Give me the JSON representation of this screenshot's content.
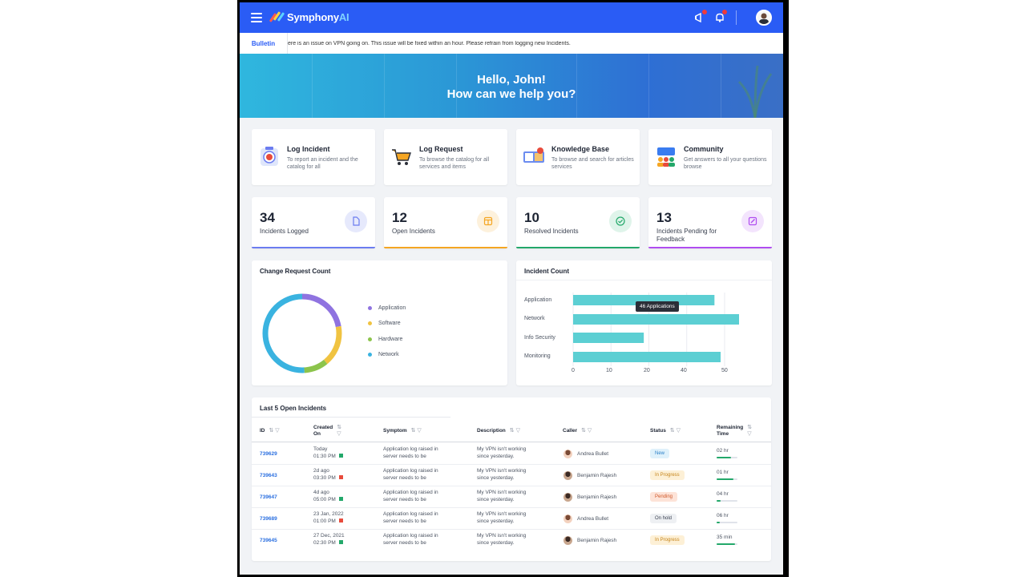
{
  "topbar": {
    "brand": "Symphony",
    "brand_suffix": "AI",
    "notification_count": "1"
  },
  "bulletin": {
    "label": "Bulletin",
    "text": "ere is an issue on VPN going on. This issue will be fixed within an hour. Please refrain from logging new Incidents."
  },
  "hero": {
    "greeting": "Hello, John!",
    "prompt": "How can we help you?"
  },
  "quick_actions": [
    {
      "title": "Log Incident",
      "desc": "To report an incident and the catalog for all",
      "icon": "incident-icon"
    },
    {
      "title": "Log Request",
      "desc": "To browse the catalog for all services and items",
      "icon": "cart-icon"
    },
    {
      "title": "Knowledge Base",
      "desc": "To browse and search for articles services",
      "icon": "knowledge-icon"
    },
    {
      "title": "Community",
      "desc": "Get answers to all your questions browse",
      "icon": "community-icon"
    }
  ],
  "stats": [
    {
      "value": "34",
      "label": "Incidents Logged",
      "color": "#6b7cf0",
      "icon": "document-icon"
    },
    {
      "value": "12",
      "label": "Open Incidents",
      "color": "#f5a623",
      "icon": "box-icon"
    },
    {
      "value": "10",
      "label": "Resolved Incidents",
      "color": "#23a86a",
      "icon": "check-icon"
    },
    {
      "value": "13",
      "label": "Incidents Pending for Feedback",
      "color": "#b04df0",
      "icon": "edit-icon"
    }
  ],
  "change_request": {
    "title": "Change Request Count",
    "chart_data": {
      "type": "pie",
      "categories": [
        "Application",
        "Software",
        "Hardware",
        "Network"
      ],
      "values": [
        22,
        17,
        10,
        51
      ],
      "colors": [
        "#8f73e0",
        "#f0c341",
        "#8cc44c",
        "#3ab3e0"
      ]
    }
  },
  "incident_count": {
    "title": "Incident Count",
    "tooltip": "46 Applications",
    "chart_data": {
      "type": "bar",
      "orientation": "horizontal",
      "categories": [
        "Application",
        "Network",
        "Info Security",
        "Monitoring"
      ],
      "values": [
        46,
        54,
        23,
        48
      ],
      "xlim": [
        0,
        55
      ],
      "xticks": [
        "0",
        "10",
        "20",
        "40",
        "50"
      ],
      "tick_values": [
        0,
        10,
        20,
        30,
        40
      ],
      "color": "#5ccfd3"
    }
  },
  "table": {
    "title": "Last 5 Open Incidents",
    "columns": [
      "ID",
      "Created On",
      "Symptom",
      "Description",
      "Caller",
      "Status",
      "Remaining Time"
    ],
    "rows": [
      {
        "id": "739629",
        "created_line1": "Today",
        "created_line2": "01:30 PM",
        "flag": "#23a86a",
        "symptom": "Application log raised in server needs to be",
        "description": "My VPN isn't working since yesterday.",
        "caller": "Andrea Bullet",
        "status": "New",
        "status_bg": "#dff1fb",
        "status_fg": "#2a7fc7",
        "remaining": "02 hr",
        "progress": 0.7
      },
      {
        "id": "739643",
        "created_line1": "2d ago",
        "created_line2": "03:30 PM",
        "flag": "#e84b3c",
        "symptom": "Application log raised in server needs to be",
        "description": "My VPN isn't working since yesterday.",
        "caller": "Benjamin Rajesh",
        "status": "In Progress",
        "status_bg": "#fdf0d6",
        "status_fg": "#c5841a",
        "remaining": "01 hr",
        "progress": 0.8
      },
      {
        "id": "739647",
        "created_line1": "4d ago",
        "created_line2": "05:00 PM",
        "flag": "#23a86a",
        "symptom": "Application log raised in server needs to be",
        "description": "My VPN isn't working since yesterday.",
        "caller": "Benjamin Rajesh",
        "status": "Pending",
        "status_bg": "#fde3d8",
        "status_fg": "#d0582a",
        "remaining": "04 hr",
        "progress": 0.2
      },
      {
        "id": "739689",
        "created_line1": "23 Jan, 2022",
        "created_line2": "01:00 PM",
        "flag": "#e84b3c",
        "symptom": "Application log raised in server needs to be",
        "description": "My VPN isn't working since yesterday.",
        "caller": "Andrea Bullet",
        "status": "On hold",
        "status_bg": "#eef0f3",
        "status_fg": "#3a4150",
        "remaining": "06 hr",
        "progress": 0.15
      },
      {
        "id": "739645",
        "created_line1": "27 Dec, 2021",
        "created_line2": "02:30 PM",
        "flag": "#23a86a",
        "symptom": "Application log raised in server needs to be",
        "description": "My VPN isn't working since yesterday.",
        "caller": "Benjamin Rajesh",
        "status": "In Progress",
        "status_bg": "#fdf0d6",
        "status_fg": "#c5841a",
        "remaining": "35 min",
        "progress": 0.9
      }
    ]
  }
}
